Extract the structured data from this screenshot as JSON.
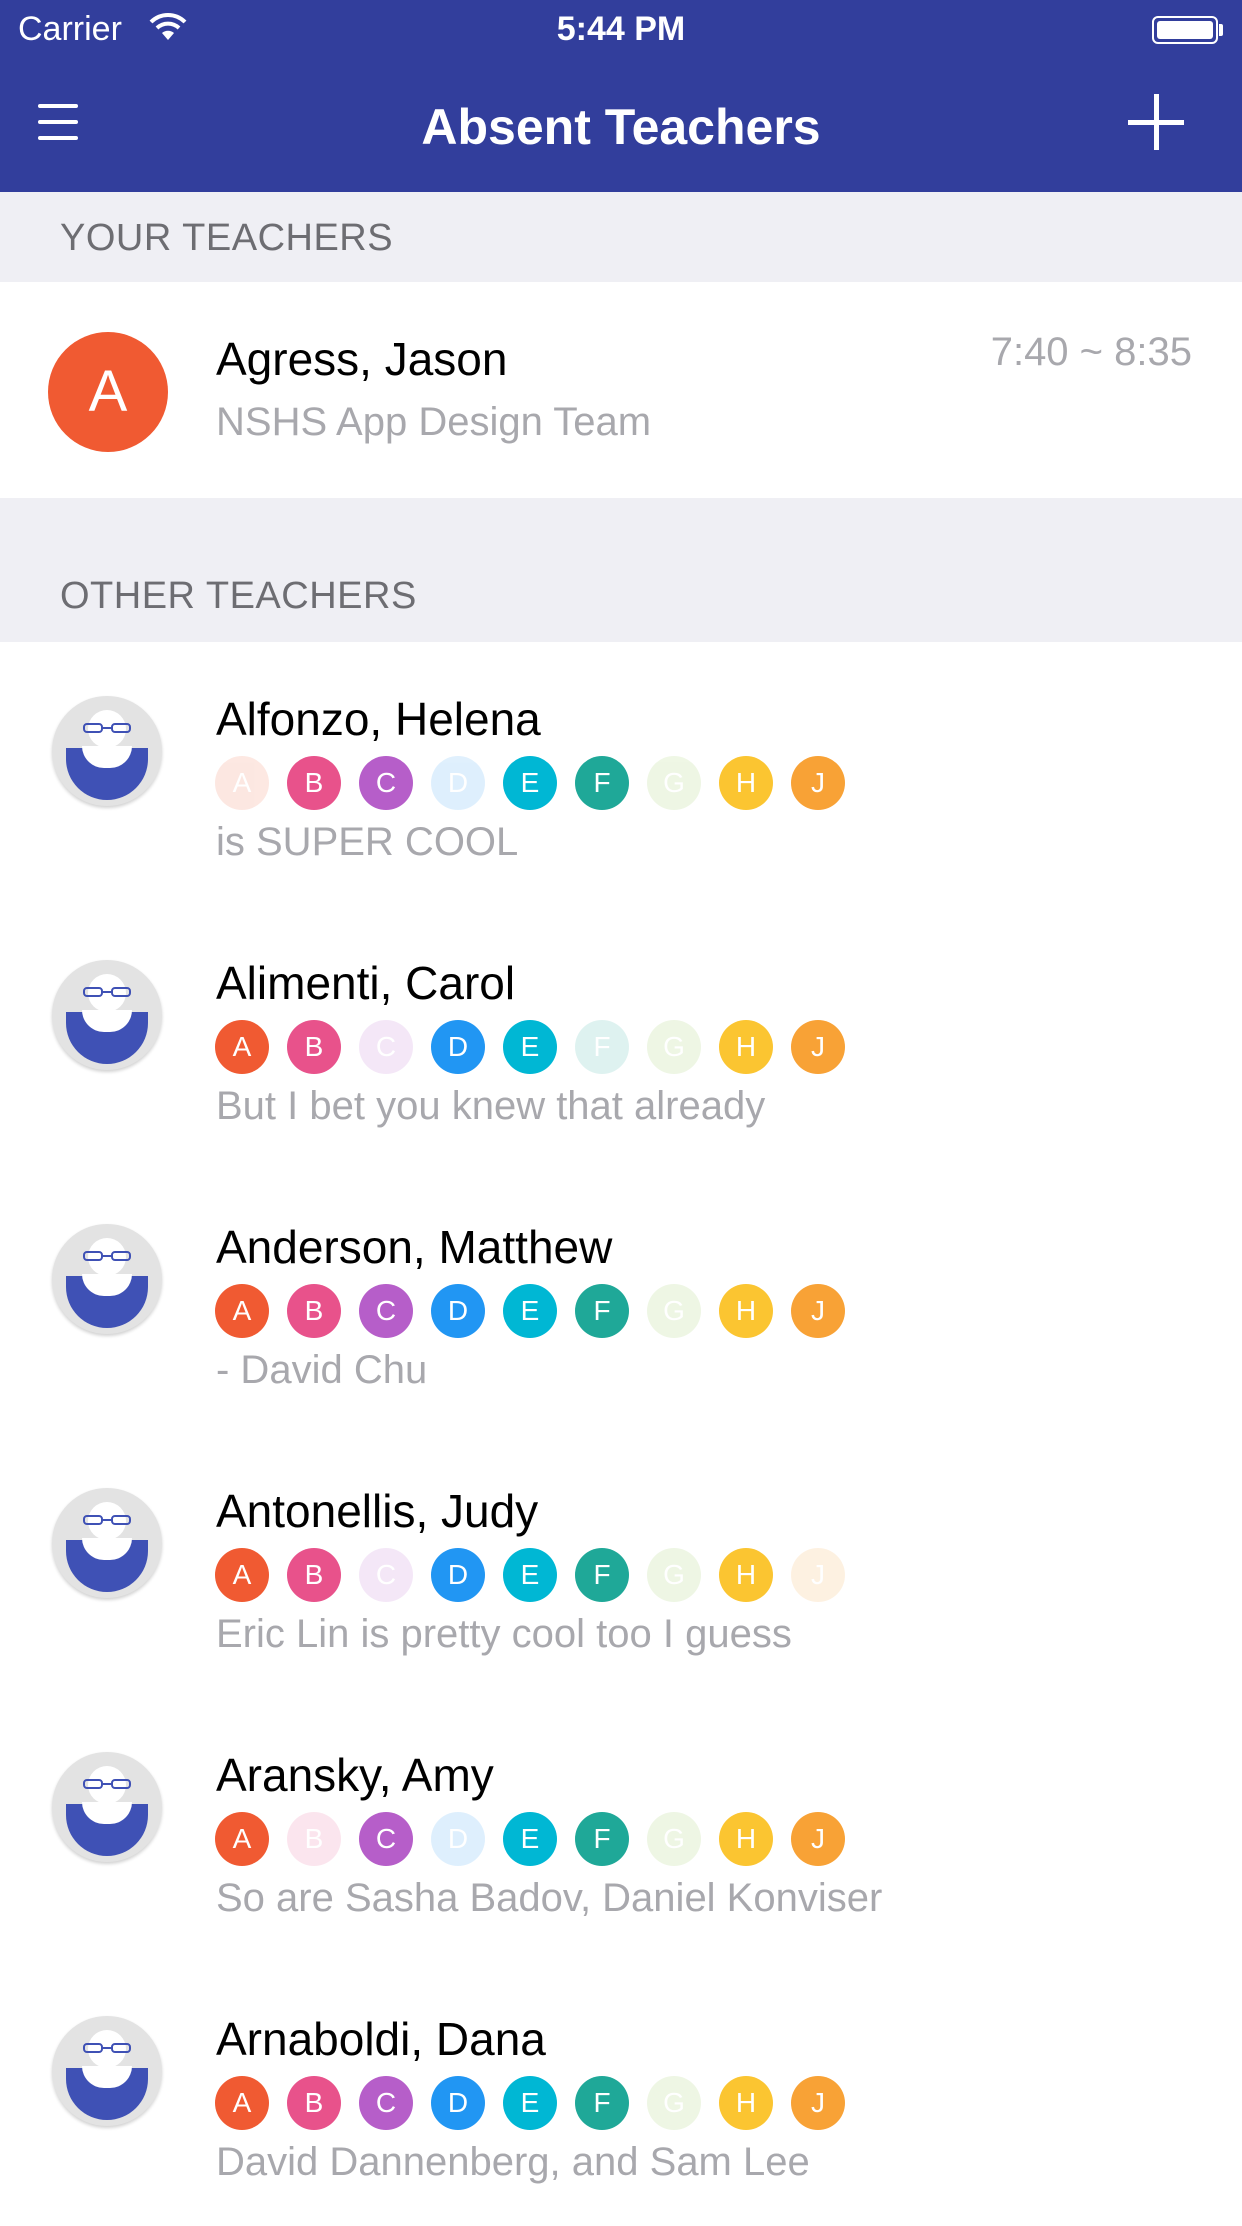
{
  "status_bar": {
    "carrier": "Carrier",
    "time": "5:44 PM"
  },
  "nav": {
    "title": "Absent Teachers",
    "menu_icon": "hamburger-menu-icon",
    "add_icon": "plus-icon"
  },
  "your_teachers": {
    "header": "YOUR TEACHERS",
    "items": [
      {
        "initial": "A",
        "name": "Agress, Jason",
        "subtitle": "NSHS App Design Team",
        "time": "7:40 ~ 8:35"
      }
    ]
  },
  "other_teachers": {
    "header": "OTHER TEACHERS",
    "period_colors": {
      "A": "#f05a32",
      "B": "#e8528b",
      "C": "#b65ec9",
      "D": "#2196f3",
      "E": "#00b7d4",
      "F": "#1fa898",
      "G": "#8bc34a",
      "H": "#fbc531",
      "J": "#f8a236"
    },
    "items": [
      {
        "name": "Alfonzo, Helena",
        "note": "is SUPER COOL",
        "periods": [
          {
            "letter": "A",
            "active": false
          },
          {
            "letter": "B",
            "active": true
          },
          {
            "letter": "C",
            "active": true
          },
          {
            "letter": "D",
            "active": false
          },
          {
            "letter": "E",
            "active": true
          },
          {
            "letter": "F",
            "active": true
          },
          {
            "letter": "G",
            "active": false
          },
          {
            "letter": "H",
            "active": true
          },
          {
            "letter": "J",
            "active": true
          }
        ]
      },
      {
        "name": "Alimenti, Carol",
        "note": "But I bet you knew that already",
        "periods": [
          {
            "letter": "A",
            "active": true
          },
          {
            "letter": "B",
            "active": true
          },
          {
            "letter": "C",
            "active": false
          },
          {
            "letter": "D",
            "active": true
          },
          {
            "letter": "E",
            "active": true
          },
          {
            "letter": "F",
            "active": false
          },
          {
            "letter": "G",
            "active": false
          },
          {
            "letter": "H",
            "active": true
          },
          {
            "letter": "J",
            "active": true
          }
        ]
      },
      {
        "name": "Anderson, Matthew",
        "note": "- David Chu",
        "periods": [
          {
            "letter": "A",
            "active": true
          },
          {
            "letter": "B",
            "active": true
          },
          {
            "letter": "C",
            "active": true
          },
          {
            "letter": "D",
            "active": true
          },
          {
            "letter": "E",
            "active": true
          },
          {
            "letter": "F",
            "active": true
          },
          {
            "letter": "G",
            "active": false
          },
          {
            "letter": "H",
            "active": true
          },
          {
            "letter": "J",
            "active": true
          }
        ]
      },
      {
        "name": "Antonellis, Judy",
        "note": "Eric Lin is pretty cool too I guess",
        "periods": [
          {
            "letter": "A",
            "active": true
          },
          {
            "letter": "B",
            "active": true
          },
          {
            "letter": "C",
            "active": false
          },
          {
            "letter": "D",
            "active": true
          },
          {
            "letter": "E",
            "active": true
          },
          {
            "letter": "F",
            "active": true
          },
          {
            "letter": "G",
            "active": false
          },
          {
            "letter": "H",
            "active": true
          },
          {
            "letter": "J",
            "active": false
          }
        ]
      },
      {
        "name": "Aransky, Amy",
        "note": "So are Sasha Badov, Daniel Konviser",
        "periods": [
          {
            "letter": "A",
            "active": true
          },
          {
            "letter": "B",
            "active": false
          },
          {
            "letter": "C",
            "active": true
          },
          {
            "letter": "D",
            "active": false
          },
          {
            "letter": "E",
            "active": true
          },
          {
            "letter": "F",
            "active": true
          },
          {
            "letter": "G",
            "active": false
          },
          {
            "letter": "H",
            "active": true
          },
          {
            "letter": "J",
            "active": true
          }
        ]
      },
      {
        "name": "Arnaboldi, Dana",
        "note": "David Dannenberg, and Sam Lee",
        "periods": [
          {
            "letter": "A",
            "active": true
          },
          {
            "letter": "B",
            "active": true
          },
          {
            "letter": "C",
            "active": true
          },
          {
            "letter": "D",
            "active": true
          },
          {
            "letter": "E",
            "active": true
          },
          {
            "letter": "F",
            "active": true
          },
          {
            "letter": "G",
            "active": false
          },
          {
            "letter": "H",
            "active": true
          },
          {
            "letter": "J",
            "active": true
          }
        ]
      }
    ]
  }
}
